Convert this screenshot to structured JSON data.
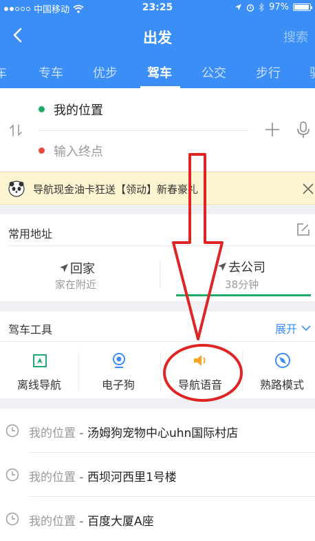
{
  "status_bar": {
    "carrier": "中国移动",
    "time": "23:25",
    "battery": "97%",
    "battery_level": 0.97
  },
  "header": {
    "title": "出发",
    "search_label": "搜索"
  },
  "tabs": [
    {
      "label": "车"
    },
    {
      "label": "专车"
    },
    {
      "label": "优步"
    },
    {
      "label": "驾车"
    },
    {
      "label": "公交"
    },
    {
      "label": "步行"
    },
    {
      "label": "骑"
    }
  ],
  "active_tab": "驾车",
  "route": {
    "from": "我的位置",
    "to_placeholder": "输入终点"
  },
  "banner": {
    "text": "导航现金油卡狂送【领动】新春豪礼"
  },
  "common_address": {
    "title": "常用地址",
    "home": {
      "label": "回家",
      "sub": "家在附近"
    },
    "work": {
      "label": "去公司",
      "sub": "38分钟"
    }
  },
  "tools": {
    "title": "驾车工具",
    "expand_label": "展开",
    "items": [
      {
        "label": "离线导航",
        "icon": "offline-map-icon",
        "color": "#1fa971"
      },
      {
        "label": "电子狗",
        "icon": "camera-icon",
        "color": "#3a8ef6"
      },
      {
        "label": "导航语音",
        "icon": "speaker-icon",
        "color": "#f5a623"
      },
      {
        "label": "熟路模式",
        "icon": "compass-icon",
        "color": "#3a8ef6"
      }
    ]
  },
  "history": [
    {
      "prefix": "我的位置",
      "sep": "-",
      "dest": "汤姆狗宠物中心uhn国际村店"
    },
    {
      "prefix": "我的位置",
      "sep": "-",
      "dest": "西坝河西里1号楼"
    },
    {
      "prefix": "我的位置",
      "sep": "-",
      "dest": "百度大厦A座"
    }
  ],
  "colors": {
    "brand_blue": "#3a8ef6",
    "green": "#20a968",
    "red_dot": "#e84a3c",
    "annotation_red": "#e02424"
  }
}
